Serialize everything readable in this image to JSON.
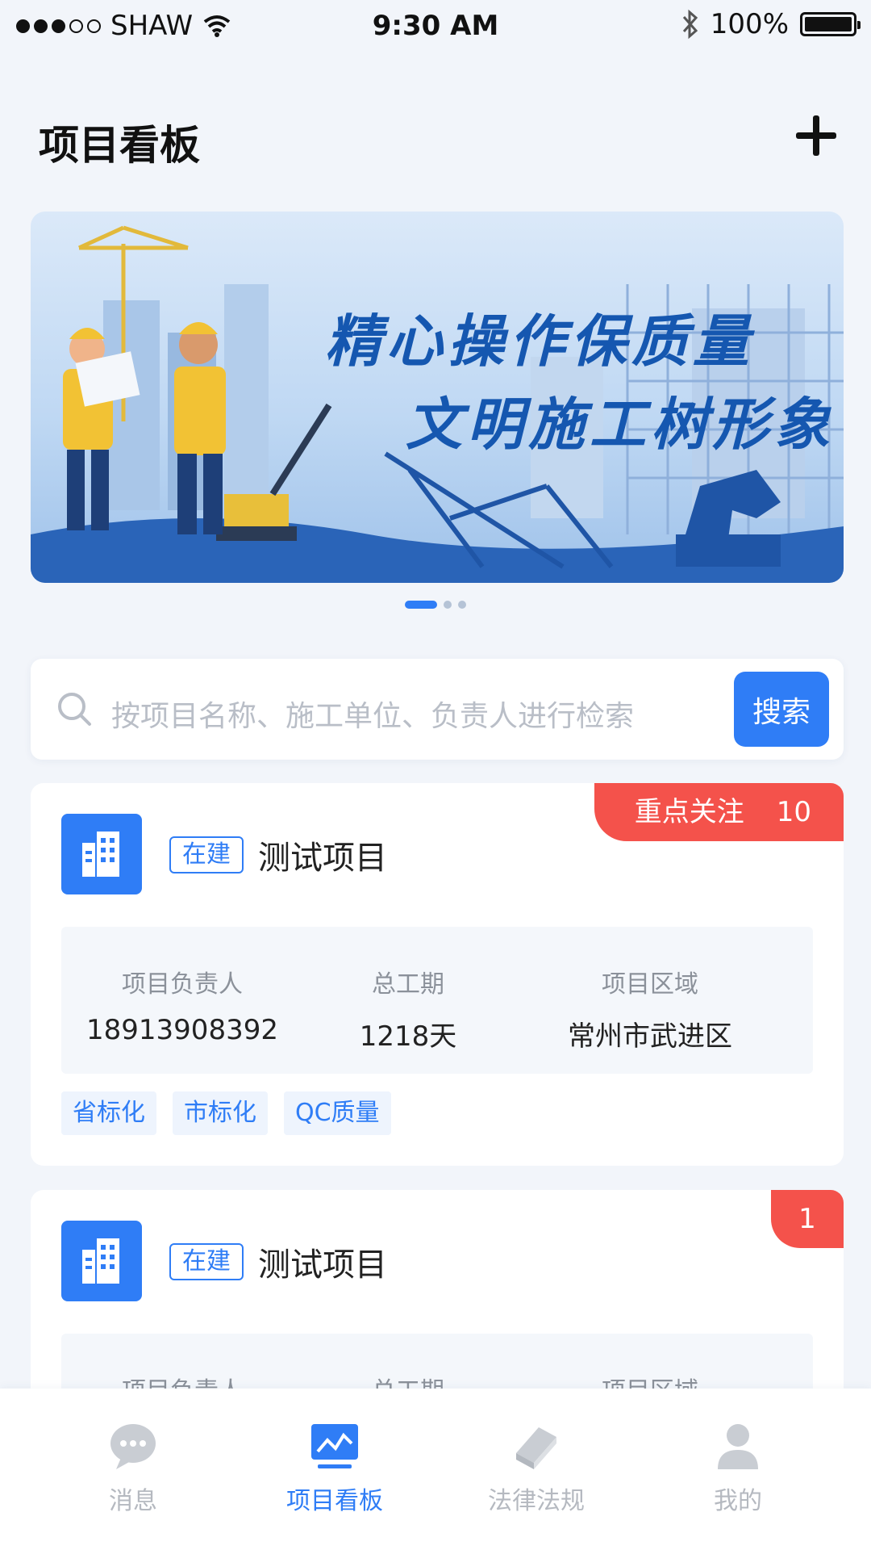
{
  "status_bar": {
    "carrier": "SHAW",
    "time": "9:30 AM",
    "battery": "100%"
  },
  "header": {
    "title": "项目看板"
  },
  "banner": {
    "line1": "精心操作保质量",
    "line2": "文明施工树形象"
  },
  "search": {
    "placeholder": "按项目名称、施工单位、负责人进行检索",
    "button_label": "搜索"
  },
  "projects": [
    {
      "status": "在建",
      "name": "测试项目",
      "focus_label": "重点关注",
      "focus_count": "10",
      "info": [
        {
          "label": "项目负责人",
          "value": "18913908392"
        },
        {
          "label": "总工期",
          "value": "1218天"
        },
        {
          "label": "项目区域",
          "value": "常州市武进区"
        }
      ],
      "tags": [
        "省标化",
        "市标化",
        "QC质量"
      ]
    },
    {
      "status": "在建",
      "name": "测试项目",
      "focus_count": "1",
      "info": [
        {
          "label": "项目负责人"
        },
        {
          "label": "总工期"
        },
        {
          "label": "项目区域"
        }
      ]
    }
  ],
  "nav": [
    {
      "label": "消息",
      "icon": "message-icon"
    },
    {
      "label": "项目看板",
      "icon": "dashboard-icon",
      "active": true
    },
    {
      "label": "法律法规",
      "icon": "book-icon"
    },
    {
      "label": "我的",
      "icon": "user-icon"
    }
  ],
  "colors": {
    "accent": "#2f7df6",
    "badge": "#f4524b"
  }
}
